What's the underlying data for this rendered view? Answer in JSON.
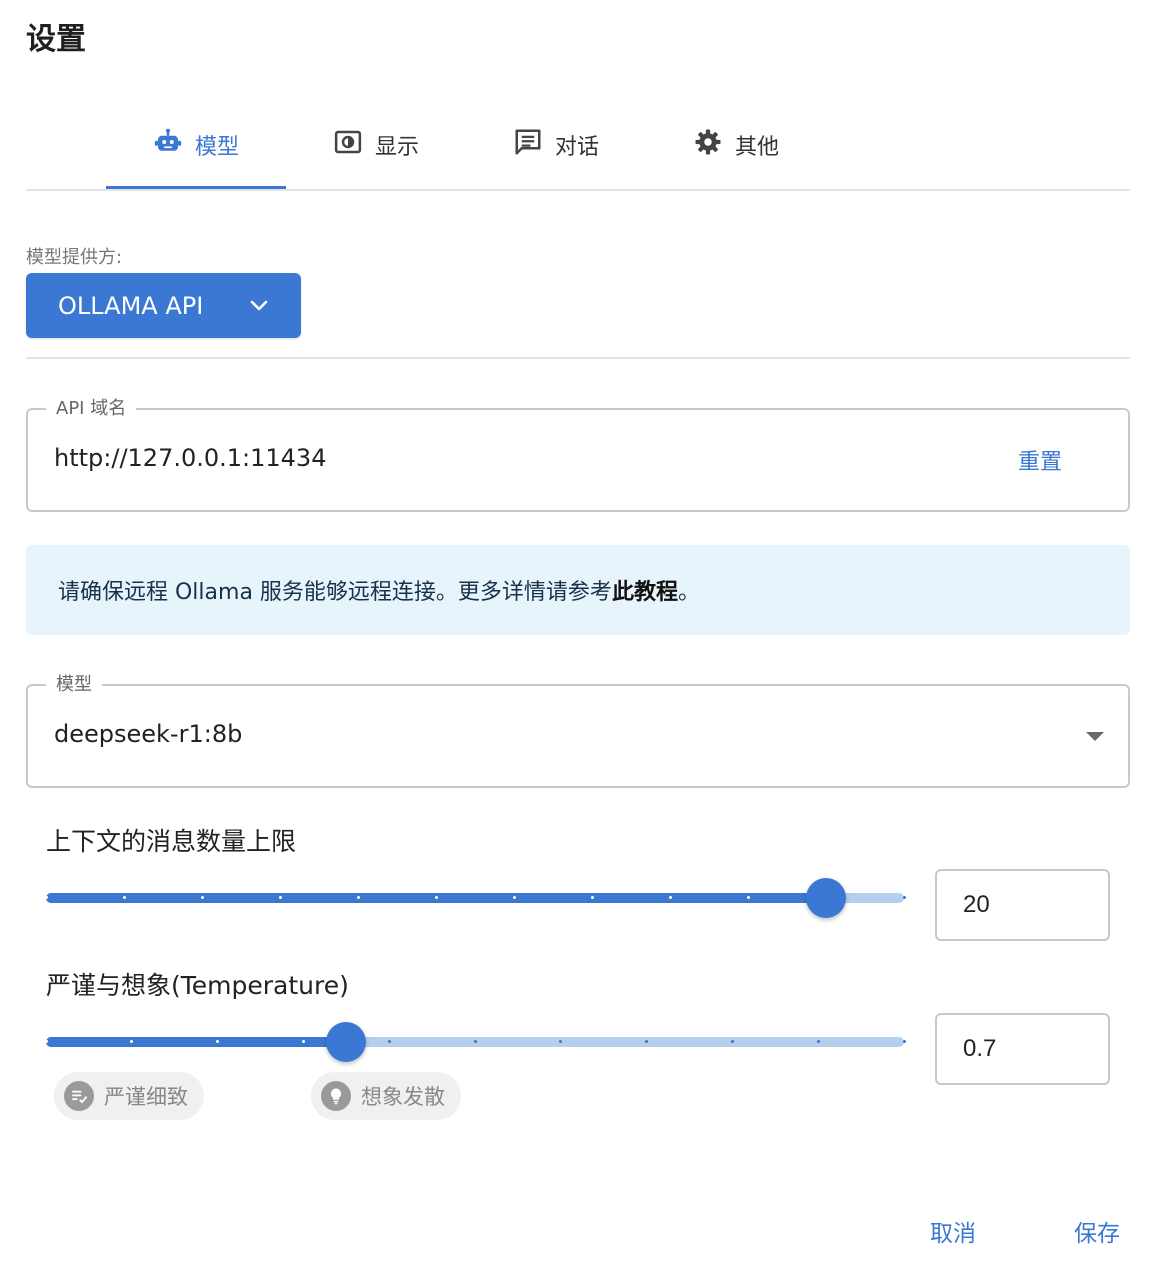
{
  "dialog": {
    "title": "设置"
  },
  "tabs": [
    {
      "label": "模型",
      "icon": "robot-icon",
      "active": true
    },
    {
      "label": "显示",
      "icon": "display-icon",
      "active": false
    },
    {
      "label": "对话",
      "icon": "chat-icon",
      "active": false
    },
    {
      "label": "其他",
      "icon": "gear-icon",
      "active": false
    }
  ],
  "provider": {
    "label": "模型提供方:",
    "value": "OLLAMA API"
  },
  "api_host": {
    "legend": "API 域名",
    "value": "http://127.0.0.1:11434",
    "reset_label": "重置"
  },
  "info": {
    "text": "请确保远程 Ollama 服务能够远程连接。更多详情请参考",
    "link": "此教程",
    "suffix": "。"
  },
  "model": {
    "legend": "模型",
    "value": "deepseek-r1:8b"
  },
  "context_limit": {
    "label": "上下文的消息数量上限",
    "value": "20",
    "fraction": 0.9091
  },
  "temperature": {
    "label": "严谨与想象(Temperature)",
    "value": "0.7",
    "fraction": 0.35,
    "chip_precise": "严谨细致",
    "chip_creative": "想象发散"
  },
  "footer": {
    "cancel": "取消",
    "save": "保存"
  },
  "colors": {
    "accent": "#3a78d4",
    "track_light": "#b5cfee",
    "info_bg": "#e8f4fc"
  }
}
